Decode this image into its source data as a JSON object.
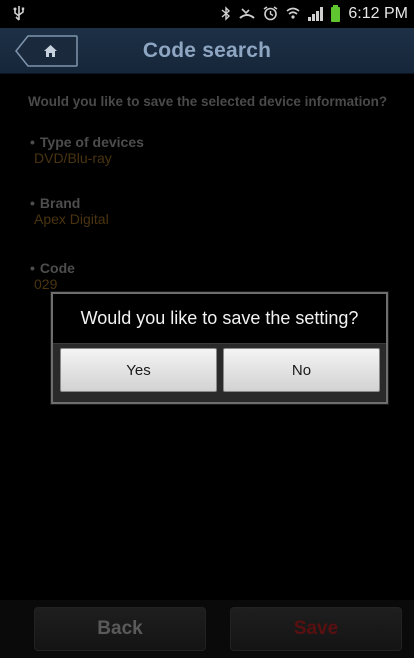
{
  "status_bar": {
    "time": "6:12 PM",
    "icons": [
      "usb-icon",
      "bluetooth-icon",
      "missed-call-icon",
      "alarm-icon",
      "wifi-icon",
      "signal-icon",
      "battery-icon"
    ]
  },
  "header": {
    "title": "Code search",
    "home_icon": "home-icon"
  },
  "main": {
    "question": "Would you like to save the selected device information?",
    "items": [
      {
        "label": "Type of devices",
        "value": "DVD/Blu-ray"
      },
      {
        "label": "Brand",
        "value": "Apex Digital"
      },
      {
        "label": "Code",
        "value": "029"
      }
    ]
  },
  "dialog": {
    "message": "Would you like to save the setting?",
    "yes_label": "Yes",
    "no_label": "No"
  },
  "footer": {
    "back_label": "Back",
    "save_label": "Save"
  },
  "colors": {
    "title": "#8ea6c2",
    "value": "#4a3410",
    "save": "#5a1010"
  }
}
